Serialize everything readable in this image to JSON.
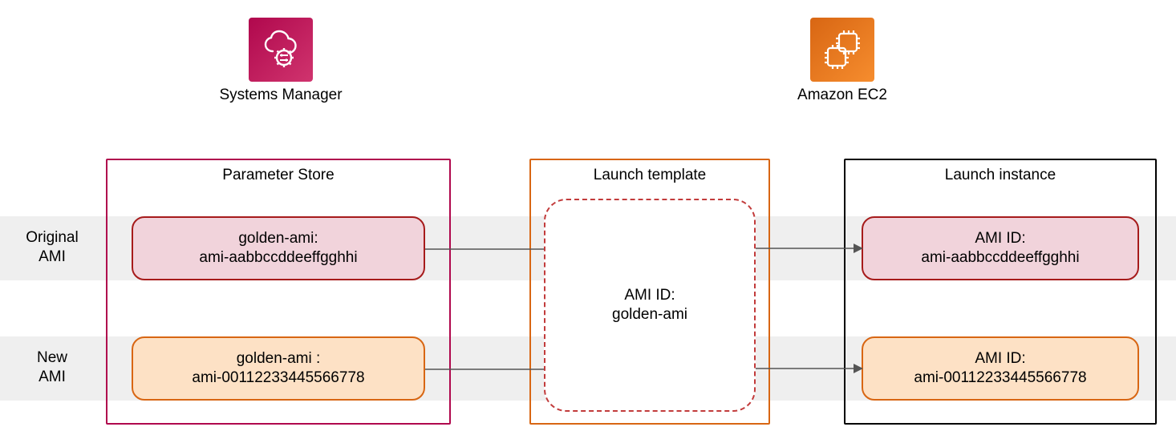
{
  "services": {
    "systems_manager": {
      "label": "Systems Manager",
      "icon": "systems-manager-icon"
    },
    "ec2": {
      "label": "Amazon EC2",
      "icon": "ec2-icon"
    }
  },
  "rows": {
    "original": {
      "label_line1": "Original",
      "label_line2": "AMI"
    },
    "new": {
      "label_line1": "New",
      "label_line2": "AMI"
    }
  },
  "parameter_store": {
    "title": "Parameter Store",
    "original": {
      "line1": "golden-ami:",
      "line2": "ami-aabbccddeeffgghhi"
    },
    "new": {
      "line1": "golden-ami :",
      "line2": "ami-00112233445566778"
    }
  },
  "launch_template": {
    "title": "Launch template",
    "ref": {
      "line1": "AMI ID:",
      "line2": "golden-ami"
    }
  },
  "launch_instance": {
    "title": "Launch instance",
    "original": {
      "line1": "AMI ID:",
      "line2": "ami-aabbccddeeffgghhi"
    },
    "new": {
      "line1": "AMI ID:",
      "line2": "ami-00112233445566778"
    }
  },
  "colors": {
    "systems_manager": "#b0084d",
    "ec2": "#d86613",
    "pill_red_border": "#a61b1b",
    "pill_red_fill": "#f1d3db",
    "pill_orange_border": "#d86613",
    "pill_orange_fill": "#fde1c5",
    "band": "#efefef"
  }
}
